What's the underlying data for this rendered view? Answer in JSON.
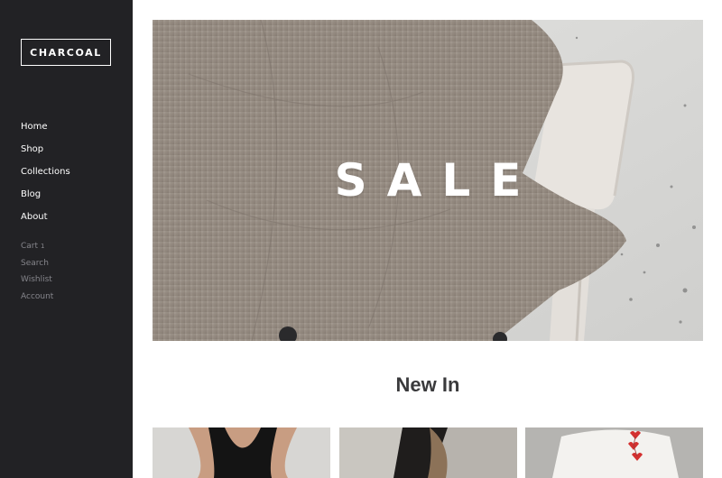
{
  "brand": {
    "logo_text": "CHARCOAL"
  },
  "nav": {
    "items": [
      {
        "label": "Home"
      },
      {
        "label": "Shop"
      },
      {
        "label": "Collections"
      },
      {
        "label": "Blog"
      },
      {
        "label": "About"
      }
    ]
  },
  "utility": {
    "cart_label": "Cart",
    "cart_count": "1",
    "search_label": "Search",
    "wishlist_label": "Wishlist",
    "account_label": "Account"
  },
  "hero": {
    "title": "SALE"
  },
  "new_in": {
    "title": "New In",
    "products": [
      {
        "image": "black-tank-top-photo"
      },
      {
        "image": "model-street-photo"
      },
      {
        "image": "white-shirt-hearts-photo"
      }
    ]
  },
  "colors": {
    "sidebar_bg": "#222225",
    "sidebar_text": "#ffffff",
    "sidebar_muted": "#85858b",
    "page_bg": "#ffffff",
    "heading": "#3a3a3c"
  }
}
